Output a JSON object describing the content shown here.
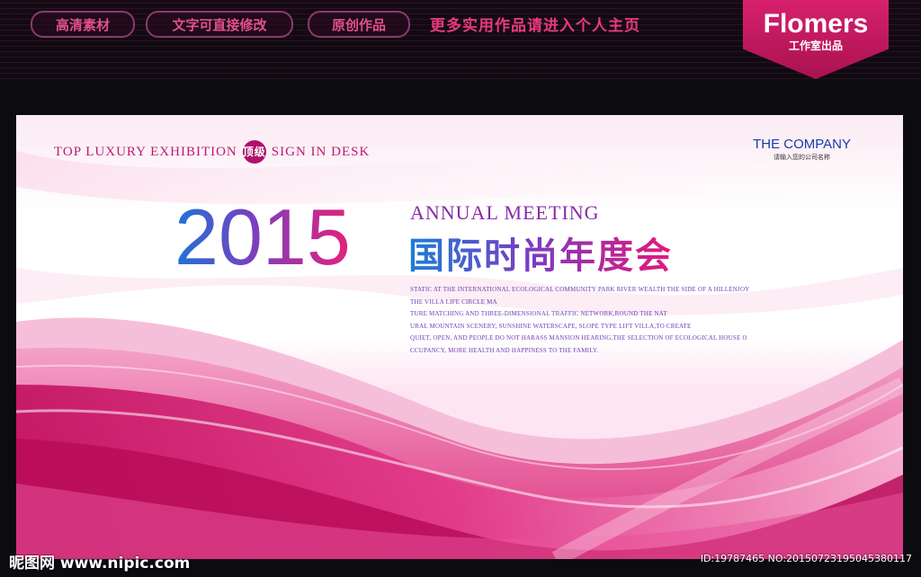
{
  "header": {
    "pills": [
      "高清素材",
      "文字可直接修改",
      "原创作品"
    ],
    "promo": "更多实用作品请进入个人主页",
    "logo_main": "Flomers",
    "logo_sub": "工作室出品"
  },
  "poster": {
    "tagline_left": "TOP LUXURY EXHIBITION",
    "tagline_badge": "顶级",
    "tagline_right": "SIGN IN DESK",
    "company_name": "THE COMPANY",
    "company_sub": "请输入您的公司名称",
    "year": "2015",
    "annual": "ANNUAL MEETING",
    "title_cn": "国际时尚年度会",
    "description": [
      "STATIC AT THE INTERNATIONAL ECOLOGICAL COMMUNITY PARK RIVER WEALTH THE SIDE OF A HILLENJOY",
      "THE VILLA LIFE CIRCLE MA",
      "TURE MATCHING AND THREE-DIMENSIONAL TRAFFIC NETWORK,ROUND THE NAT",
      "URAL MOUNTAIN SCENERY, SUNSHINE WATERSCAPE, SLOPE TYPE LIFT VILLA,TO CREATE",
      "QUIET, OPEN, AND PEOPLE DO NOT HARASS MANSION HEARING,THE SELECTION OF ECOLOGICAL HOUSE O",
      "CCUPANCY, MORE HEALTH AND HAPPINESS TO THE FAMILY."
    ]
  },
  "watermark": {
    "left": "昵图网 www.nipic.com",
    "right": "ID:19787465 NO:20150723195045380117"
  },
  "colors": {
    "accent": "#e4217a",
    "blue": "#1d73d6",
    "purple": "#7b3fc0"
  }
}
